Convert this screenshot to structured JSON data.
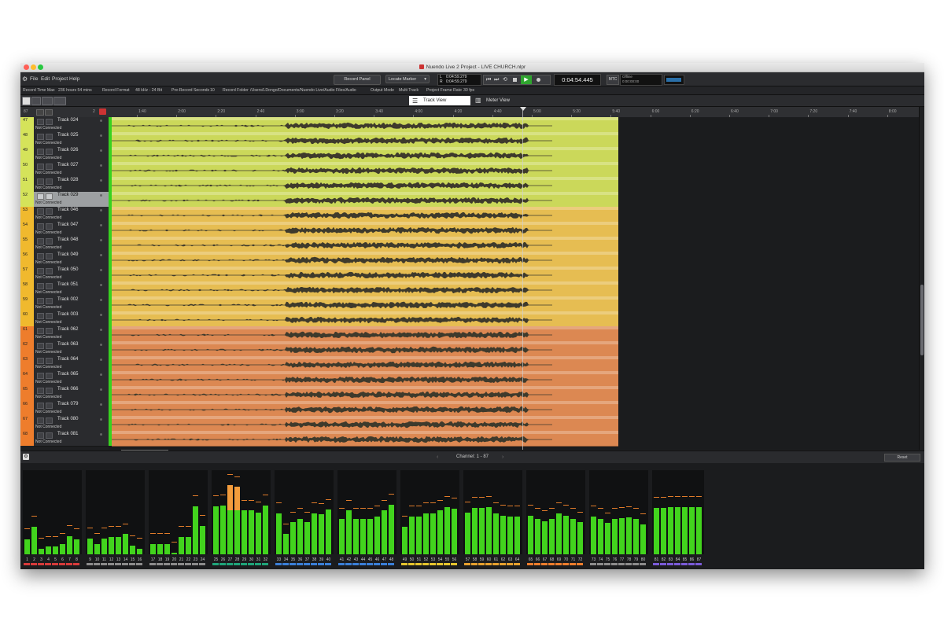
{
  "window": {
    "title": "Nuendo Live 2 Project - LIVE CHURCH.nlpr"
  },
  "menu": [
    "File",
    "Edit",
    "Project",
    "Help"
  ],
  "transport": {
    "record_panel": "Record Panel",
    "locate_marker": "Locate Marker",
    "time_l": "0:04:59.279",
    "time_r": "0:04:59.279",
    "l_label": "L",
    "r_label": "R",
    "position": "0:04:54.445",
    "mtc": "MTC",
    "mtc_status": "Offline",
    "mtc_time": "0:00:00:00"
  },
  "info": {
    "record_time_max_label": "Record Time Max",
    "record_time_max": "236 hours 54 mins",
    "record_format_label": "Record Format",
    "record_format": "48 kHz - 24 Bit",
    "pre_record_label": "Pre-Record Seconds",
    "pre_record": "10",
    "record_folder_label": "Record Folder",
    "record_folder": "/Users/LDongo/Documents/Nuendo Live/Audio Files/Audio",
    "output_mode_label": "Output Mode",
    "output_mode": "Multi Track",
    "frame_rate_label": "Project Frame Rate",
    "frame_rate": "30 fps"
  },
  "tabs": {
    "track_view": "Track View",
    "meter_view": "Meter View"
  },
  "track_header": {
    "count": "87",
    "page": "2"
  },
  "ruler": [
    "1:40",
    "2:00",
    "2:20",
    "2:40",
    "3:00",
    "3:20",
    "3:40",
    "4:00",
    "4:20",
    "4:40",
    "5:00",
    "5:20",
    "5:40",
    "6:00",
    "6:20",
    "6:40",
    "7:00",
    "7:20",
    "7:40",
    "8:00"
  ],
  "tracks": [
    {
      "num": "47",
      "name": "Track 024",
      "status": "Not Connected",
      "color": "#d5e35a",
      "lane": "#cbd85a"
    },
    {
      "num": "48",
      "name": "Track 025",
      "status": "Not Connected",
      "color": "#d5e35a",
      "lane": "#cbd85a"
    },
    {
      "num": "49",
      "name": "Track 026",
      "status": "Not Connected",
      "color": "#d5e35a",
      "lane": "#cbd85a"
    },
    {
      "num": "50",
      "name": "Track 027",
      "status": "Not Connected",
      "color": "#d5e35a",
      "lane": "#cbd85a"
    },
    {
      "num": "51",
      "name": "Track 028",
      "status": "Not Connected",
      "color": "#d5e35a",
      "lane": "#cbd85a"
    },
    {
      "num": "52",
      "name": "Track 029",
      "status": "Not Connected",
      "color": "#d5e35a",
      "lane": "#cbd85a",
      "selected": true
    },
    {
      "num": "53",
      "name": "Track 046",
      "status": "Not Connected",
      "color": "#f0b92e",
      "lane": "#e6bd52"
    },
    {
      "num": "54",
      "name": "Track 047",
      "status": "Not Connected",
      "color": "#f0b92e",
      "lane": "#e6bd52"
    },
    {
      "num": "55",
      "name": "Track 048",
      "status": "Not Connected",
      "color": "#f0b92e",
      "lane": "#e6bd52"
    },
    {
      "num": "56",
      "name": "Track 049",
      "status": "Not Connected",
      "color": "#f0b92e",
      "lane": "#e6bd52"
    },
    {
      "num": "57",
      "name": "Track 050",
      "status": "Not Connected",
      "color": "#f0b92e",
      "lane": "#e6bd52"
    },
    {
      "num": "58",
      "name": "Track 051",
      "status": "Not Connected",
      "color": "#f0b92e",
      "lane": "#e6bd52"
    },
    {
      "num": "59",
      "name": "Track 002",
      "status": "Not Connected",
      "color": "#f0b92e",
      "lane": "#e6bd52"
    },
    {
      "num": "60",
      "name": "Track 003",
      "status": "Not Connected",
      "color": "#f0b92e",
      "lane": "#e6bd52"
    },
    {
      "num": "61",
      "name": "Track 062",
      "status": "Not Connected",
      "color": "#ee7d2c",
      "lane": "#dc8852"
    },
    {
      "num": "62",
      "name": "Track 063",
      "status": "Not Connected",
      "color": "#ee7d2c",
      "lane": "#dc8852"
    },
    {
      "num": "63",
      "name": "Track 064",
      "status": "Not Connected",
      "color": "#ee7d2c",
      "lane": "#dc8852"
    },
    {
      "num": "64",
      "name": "Track 065",
      "status": "Not Connected",
      "color": "#ee7d2c",
      "lane": "#dc8852"
    },
    {
      "num": "65",
      "name": "Track 066",
      "status": "Not Connected",
      "color": "#ee7d2c",
      "lane": "#dc8852"
    },
    {
      "num": "66",
      "name": "Track 079",
      "status": "Not Connected",
      "color": "#ee7d2c",
      "lane": "#dc8852"
    },
    {
      "num": "67",
      "name": "Track 080",
      "status": "Not Connected",
      "color": "#ee7d2c",
      "lane": "#dc8852"
    },
    {
      "num": "68",
      "name": "Track 081",
      "status": "Not Connected",
      "color": "#ee7d2c",
      "lane": "#dc8852"
    }
  ],
  "meter_panel": {
    "channel_label": "Channel: 1 - 87",
    "reset": "Reset"
  },
  "meter_groups": [
    {
      "labels": [
        "1",
        "2",
        "3",
        "4",
        "5",
        "6",
        "7",
        "8"
      ],
      "levels": [
        0.18,
        0.33,
        0.07,
        0.09,
        0.09,
        0.12,
        0.22,
        0.18
      ],
      "color": "#d83a3a"
    },
    {
      "labels": [
        "9",
        "10",
        "11",
        "12",
        "13",
        "14",
        "15",
        "16"
      ],
      "levels": [
        0.19,
        0.12,
        0.19,
        0.21,
        0.21,
        0.24,
        0.1,
        0.07
      ],
      "color": "#8c8c8c"
    },
    {
      "labels": [
        "17",
        "18",
        "19",
        "20",
        "21",
        "22",
        "23",
        "24"
      ],
      "levels": [
        0.12,
        0.12,
        0.12,
        0.02,
        0.21,
        0.21,
        0.57,
        0.34
      ],
      "color": "#8c8c8c"
    },
    {
      "labels": [
        "25",
        "26",
        "27",
        "28",
        "29",
        "30",
        "31",
        "32"
      ],
      "levels": [
        0.57,
        0.58,
        0.82,
        0.8,
        0.52,
        0.52,
        0.5,
        0.58
      ],
      "color": "#1fa57a"
    },
    {
      "labels": [
        "33",
        "34",
        "35",
        "36",
        "37",
        "38",
        "39",
        "40"
      ],
      "levels": [
        0.49,
        0.24,
        0.38,
        0.42,
        0.38,
        0.49,
        0.48,
        0.53
      ],
      "color": "#3a7fd8"
    },
    {
      "labels": [
        "41",
        "42",
        "43",
        "44",
        "45",
        "46",
        "47",
        "48"
      ],
      "levels": [
        0.42,
        0.52,
        0.42,
        0.42,
        0.42,
        0.45,
        0.52,
        0.59
      ],
      "color": "#3a7fd8"
    },
    {
      "labels": [
        "49",
        "50",
        "51",
        "52",
        "53",
        "54",
        "55",
        "56"
      ],
      "levels": [
        0.33,
        0.45,
        0.45,
        0.49,
        0.49,
        0.52,
        0.56,
        0.54
      ],
      "color": "#e6c42e"
    },
    {
      "labels": [
        "57",
        "58",
        "59",
        "60",
        "61",
        "62",
        "63",
        "64"
      ],
      "levels": [
        0.5,
        0.55,
        0.55,
        0.56,
        0.49,
        0.46,
        0.45,
        0.45
      ],
      "color": "#e6a02e"
    },
    {
      "labels": [
        "65",
        "66",
        "67",
        "68",
        "69",
        "70",
        "71",
        "72"
      ],
      "levels": [
        0.46,
        0.42,
        0.39,
        0.42,
        0.49,
        0.46,
        0.42,
        0.38
      ],
      "color": "#ee7d2c"
    },
    {
      "labels": [
        "73",
        "74",
        "75",
        "76",
        "77",
        "78",
        "79",
        "80"
      ],
      "levels": [
        0.45,
        0.42,
        0.37,
        0.42,
        0.43,
        0.44,
        0.42,
        0.36
      ],
      "color": "#8c8c8c"
    },
    {
      "labels": [
        "81",
        "82",
        "83",
        "84",
        "85",
        "86",
        "87"
      ],
      "levels": [
        0.55,
        0.55,
        0.56,
        0.56,
        0.56,
        0.56,
        0.56
      ],
      "color": "#7a5ad8"
    }
  ],
  "colors": {
    "meter_green": "#42d41d",
    "meter_peak": "#e07b2a",
    "meter_overload": "#f39c3c"
  }
}
